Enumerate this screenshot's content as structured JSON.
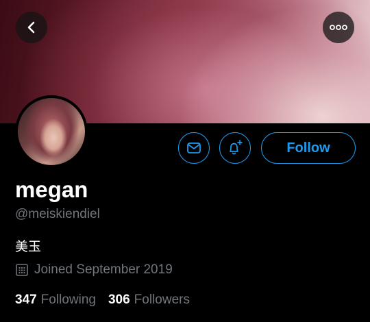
{
  "profile": {
    "name": "megan",
    "handle": "@meiskiendiel",
    "bio": "美玉",
    "joined": "Joined September 2019",
    "following_count": "347",
    "following_label": "Following",
    "followers_count": "306",
    "followers_label": "Followers"
  },
  "actions": {
    "follow_label": "Follow"
  },
  "icons": {
    "back": "back-arrow-icon",
    "more": "more-icon",
    "message": "envelope-icon",
    "notify": "bell-plus-icon",
    "calendar": "calendar-icon"
  },
  "colors": {
    "accent": "#1d9bf0",
    "secondary_text": "#71767b",
    "background": "#000000"
  }
}
